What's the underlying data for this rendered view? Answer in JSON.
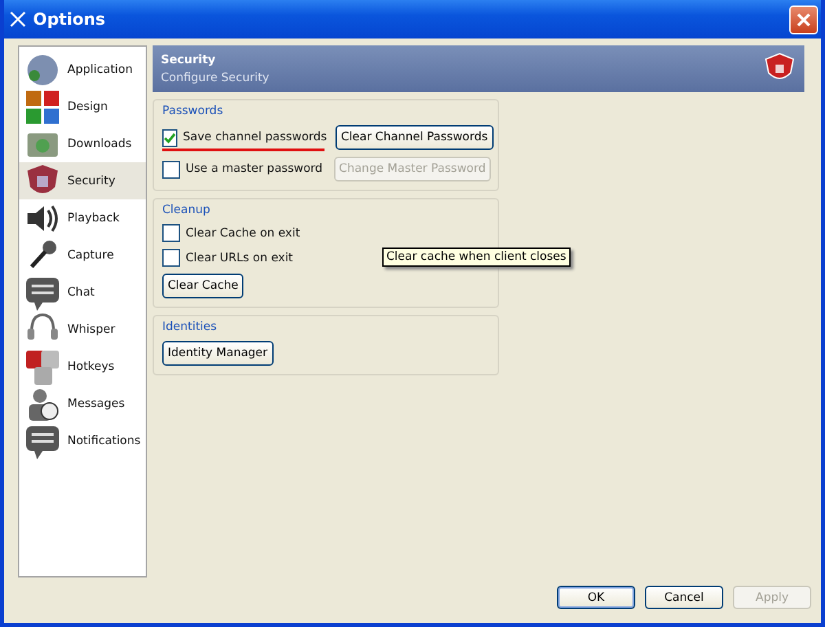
{
  "window": {
    "title": "Options"
  },
  "sidebar": {
    "items": [
      {
        "label": "Application",
        "selected": false
      },
      {
        "label": "Design",
        "selected": false
      },
      {
        "label": "Downloads",
        "selected": false
      },
      {
        "label": "Security",
        "selected": true
      },
      {
        "label": "Playback",
        "selected": false
      },
      {
        "label": "Capture",
        "selected": false
      },
      {
        "label": "Chat",
        "selected": false
      },
      {
        "label": "Whisper",
        "selected": false
      },
      {
        "label": "Hotkeys",
        "selected": false
      },
      {
        "label": "Messages",
        "selected": false
      },
      {
        "label": "Notifications",
        "selected": false
      }
    ]
  },
  "header": {
    "title": "Security",
    "subtitle": "Configure Security"
  },
  "groups": [
    {
      "title": "Passwords",
      "rows": [
        {
          "checkbox": {
            "label": "Save channel passwords",
            "checked": true,
            "underlined": true
          },
          "button": {
            "label": "Clear Channel Passwords",
            "disabled": false
          }
        },
        {
          "checkbox": {
            "label": "Use a master password",
            "checked": false,
            "underlined": false
          },
          "button": {
            "label": "Change Master Password",
            "disabled": true
          }
        }
      ]
    },
    {
      "title": "Cleanup",
      "rows": [
        {
          "checkbox": {
            "label": "Clear Cache on exit",
            "checked": false,
            "underlined": false
          }
        },
        {
          "checkbox": {
            "label": "Clear URLs on exit",
            "checked": false,
            "underlined": false
          }
        },
        {
          "button": {
            "label": "Clear Cache",
            "disabled": false
          }
        }
      ]
    },
    {
      "title": "Identities",
      "rows": [
        {
          "button": {
            "label": "Identity Manager",
            "disabled": false
          }
        }
      ]
    }
  ],
  "tooltip": "Clear cache when client closes",
  "buttons": [
    {
      "label": "OK",
      "disabled": false,
      "default": true
    },
    {
      "label": "Cancel",
      "disabled": false,
      "default": false
    },
    {
      "label": "Apply",
      "disabled": true,
      "default": false
    }
  ]
}
